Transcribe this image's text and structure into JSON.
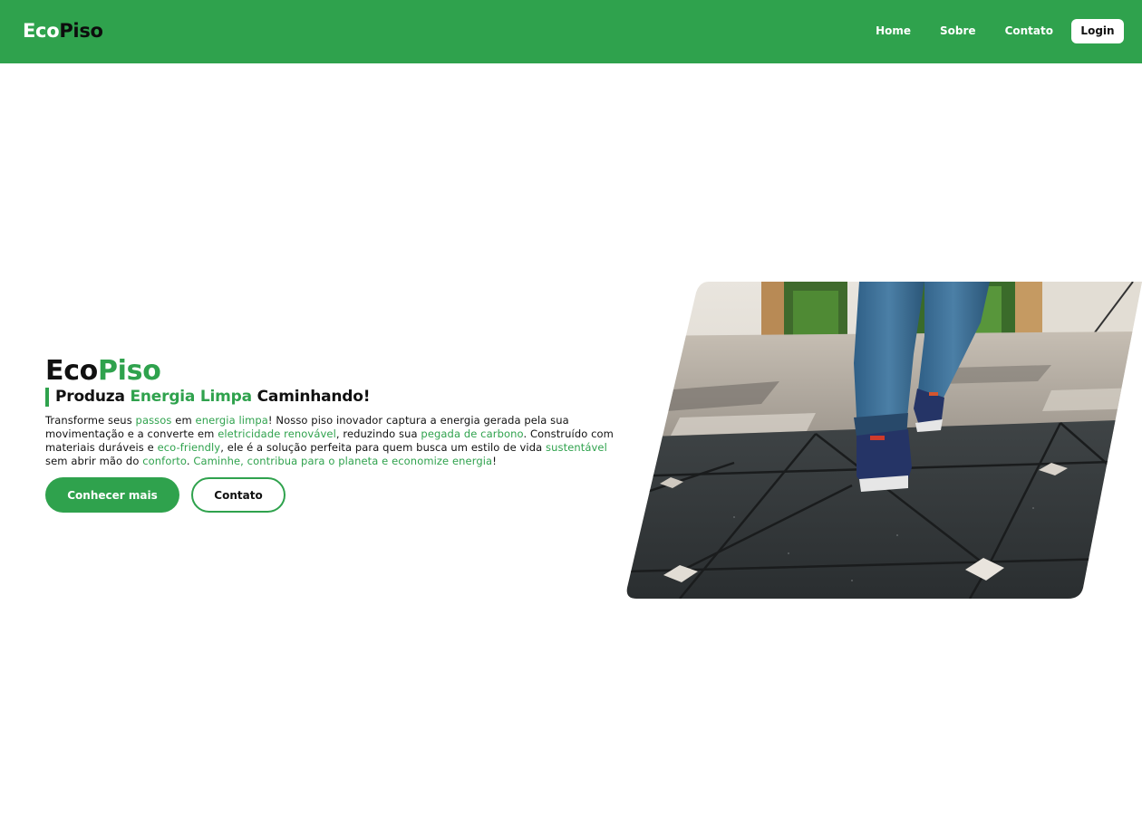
{
  "header": {
    "brand_part1": "Eco",
    "brand_part2": "Piso",
    "nav": [
      "Home",
      "Sobre",
      "Contato"
    ],
    "login_label": "Login"
  },
  "hero": {
    "title_part1": "Eco",
    "title_part2": "Piso",
    "subtitle": {
      "pre": "Produza ",
      "highlight": "Energia Limpa",
      "post": " Caminhando!"
    },
    "description": [
      {
        "text": "Transforme seus ",
        "green": false
      },
      {
        "text": "passos",
        "green": true
      },
      {
        "text": " em ",
        "green": false
      },
      {
        "text": "energia limpa",
        "green": true
      },
      {
        "text": "! Nosso piso inovador captura a energia gerada pela sua movimentação e a converte em ",
        "green": false
      },
      {
        "text": "eletricidade renovável",
        "green": true
      },
      {
        "text": ", reduzindo sua ",
        "green": false
      },
      {
        "text": "pegada de carbono",
        "green": true
      },
      {
        "text": ". Construído com materiais duráveis e ",
        "green": false
      },
      {
        "text": "eco-friendly",
        "green": true
      },
      {
        "text": ", ele é a solução perfeita para quem busca um estilo de vida ",
        "green": false
      },
      {
        "text": "sustentável",
        "green": true
      },
      {
        "text": " sem abrir mão do ",
        "green": false
      },
      {
        "text": "conforto",
        "green": true
      },
      {
        "text": ". ",
        "green": false
      },
      {
        "text": "Caminhe, contribua para o planeta e economize energia",
        "green": true
      },
      {
        "text": "!",
        "green": false
      }
    ],
    "primary_button": "Conhecer mais",
    "secondary_button": "Contato",
    "image_subject": "feet-walking-on-energy-floor-photo"
  },
  "colors": {
    "accent": "#2fa24d",
    "text": "#111111",
    "background": "#ffffff"
  }
}
